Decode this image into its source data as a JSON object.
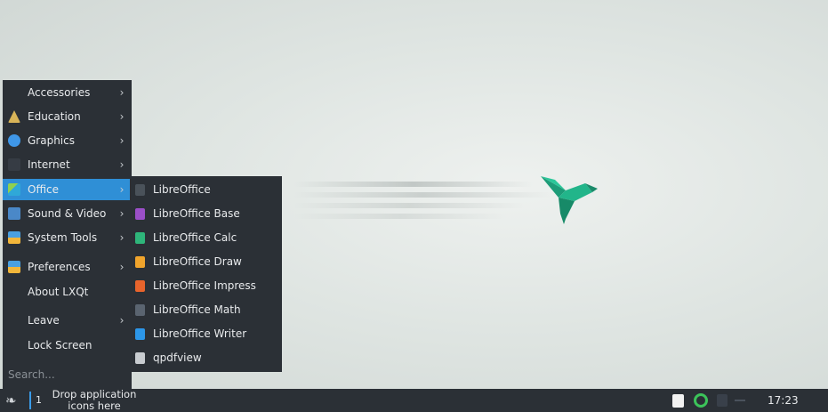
{
  "desktop": {
    "wallpaper_logo": "hummingbird-logo"
  },
  "menu": {
    "items": [
      {
        "label": "Accessories",
        "icon": "accessories-icon",
        "color": "",
        "submenu": true
      },
      {
        "label": "Education",
        "icon": "education-icon",
        "color": "#d8b458",
        "submenu": true
      },
      {
        "label": "Graphics",
        "icon": "graphics-icon",
        "color": "#3f97e8",
        "submenu": true
      },
      {
        "label": "Internet",
        "icon": "internet-icon",
        "color": "#3a4048",
        "submenu": true
      },
      {
        "label": "Office",
        "icon": "office-icon",
        "color": "#2fa8d8",
        "submenu": true,
        "active": true
      },
      {
        "label": "Sound & Video",
        "icon": "sound-video-icon",
        "color": "#4a88c8",
        "submenu": true
      },
      {
        "label": "System Tools",
        "icon": "system-tools-icon",
        "color": "#4aa0e0",
        "submenu": true
      },
      {
        "label": "Preferences",
        "icon": "preferences-icon",
        "color": "#4aa0e0",
        "submenu": true
      },
      {
        "label": "About LXQt",
        "icon": "about-lxqt-icon",
        "color": "",
        "submenu": false
      },
      {
        "label": "Leave",
        "icon": "leave-icon",
        "color": "",
        "submenu": true
      },
      {
        "label": "Lock Screen",
        "icon": "lock-screen-icon",
        "color": "",
        "submenu": false
      }
    ],
    "search_placeholder": "Search..."
  },
  "submenu": {
    "items": [
      {
        "label": "LibreOffice",
        "icon": "libreoffice-icon",
        "color": "#4a525a"
      },
      {
        "label": "LibreOffice Base",
        "icon": "libreoffice-base-icon",
        "color": "#9b4fc8"
      },
      {
        "label": "LibreOffice Calc",
        "icon": "libreoffice-calc-icon",
        "color": "#2eb57a"
      },
      {
        "label": "LibreOffice Draw",
        "icon": "libreoffice-draw-icon",
        "color": "#f0a42c"
      },
      {
        "label": "LibreOffice Impress",
        "icon": "libreoffice-impress-icon",
        "color": "#e8642c"
      },
      {
        "label": "LibreOffice Math",
        "icon": "libreoffice-math-icon",
        "color": "#5a6470"
      },
      {
        "label": "LibreOffice Writer",
        "icon": "libreoffice-writer-icon",
        "color": "#2c96e8"
      },
      {
        "label": "qpdfview",
        "icon": "qpdfview-icon",
        "color": "#c8ccd0"
      }
    ]
  },
  "taskbar": {
    "desktop_number": "1",
    "drop_line1": "Drop application",
    "drop_line2": "icons here",
    "clock": "17:23"
  },
  "colors": {
    "menu_bg": "#2b3036",
    "accent": "#2f8fd6",
    "brand": "#1aa37f"
  }
}
